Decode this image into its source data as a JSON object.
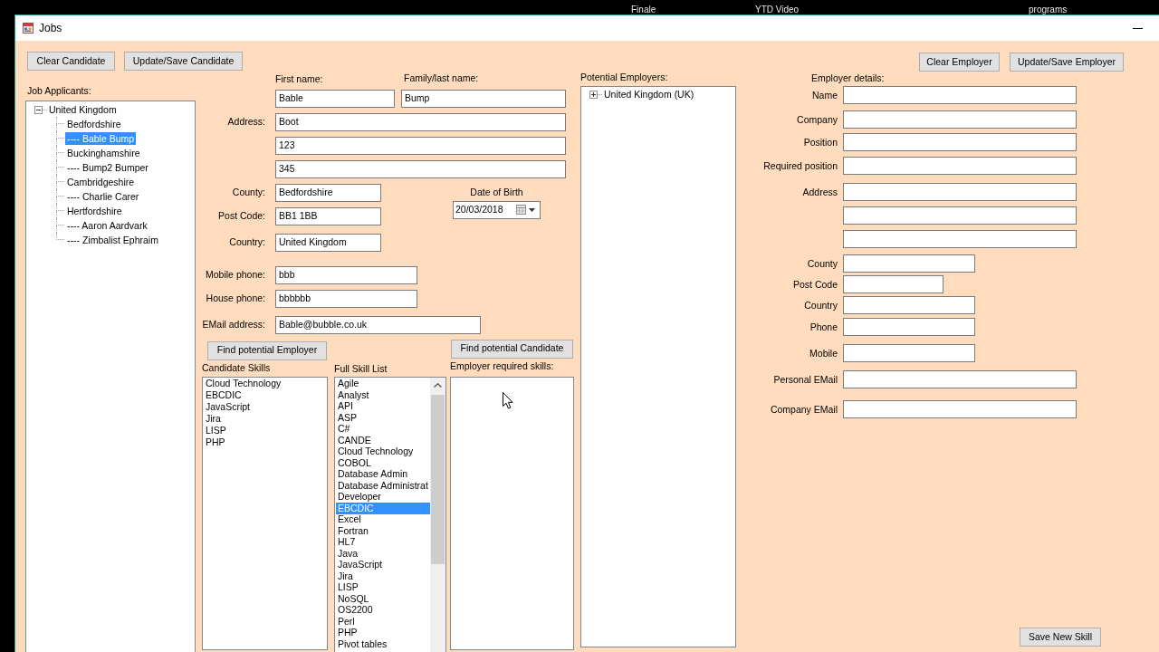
{
  "desktop": {
    "labels": [
      "Finale",
      "YTD Video",
      "programs"
    ]
  },
  "window": {
    "title": "Jobs"
  },
  "candidate_buttons": [
    "Clear Candidate",
    "Update/Save Candidate"
  ],
  "job_applicants": {
    "label": "Job Applicants:",
    "tree": [
      {
        "text": "United Kingdom",
        "expanded": true,
        "selected": false,
        "children": [
          {
            "text": "Bedfordshire",
            "selected": false
          },
          {
            "text": "---- Bable Bump",
            "selected": true
          },
          {
            "text": "Buckinghamshire",
            "selected": false
          },
          {
            "text": "---- Bump2 Bumper",
            "selected": false
          },
          {
            "text": "Cambridgeshire",
            "selected": false
          },
          {
            "text": "---- Charlie Carer",
            "selected": false
          },
          {
            "text": "Hertfordshire",
            "selected": false
          },
          {
            "text": "---- Aaron Aardvark",
            "selected": false
          },
          {
            "text": "---- Zimbalist Ephraim",
            "selected": false
          }
        ]
      }
    ]
  },
  "candidate_form": {
    "first_name": {
      "label": "First name:",
      "value": "Bable"
    },
    "last_name": {
      "label": "Family/last name:",
      "value": "Bump"
    },
    "address": {
      "label": "Address:",
      "lines": [
        "Boot",
        "123",
        "345"
      ]
    },
    "county": {
      "label": "County:",
      "value": "Bedfordshire"
    },
    "post_code": {
      "label": "Post Code:",
      "value": "BB1 1BB"
    },
    "country": {
      "label": "Country:",
      "value": "United Kingdom"
    },
    "date_of_birth": {
      "label": "Date of Birth",
      "value": "20/03/2018"
    },
    "mobile_phone": {
      "label": "Mobile phone:",
      "value": "bbb"
    },
    "house_phone": {
      "label": "House phone:",
      "value": "bbbbbb"
    },
    "email": {
      "label": "EMail address:",
      "value": "Bable@bubble.co.uk"
    }
  },
  "find_employer_button": "Find potential Employer",
  "find_candidate_button": "Find potential Candidate",
  "candidate_skills": {
    "label": "Candidate Skills",
    "items": [
      {
        "text": "Cloud Technology",
        "selected": false
      },
      {
        "text": "EBCDIC",
        "selected": false
      },
      {
        "text": "JavaScript",
        "selected": false
      },
      {
        "text": "Jira",
        "selected": false
      },
      {
        "text": "LISP",
        "selected": false
      },
      {
        "text": "PHP",
        "selected": false
      }
    ]
  },
  "full_skill_list": {
    "label": "Full Skill List",
    "items": [
      {
        "text": "Agile",
        "selected": false
      },
      {
        "text": "Analyst",
        "selected": false
      },
      {
        "text": "API",
        "selected": false
      },
      {
        "text": "ASP",
        "selected": false
      },
      {
        "text": "C#",
        "selected": false
      },
      {
        "text": "CANDE",
        "selected": false
      },
      {
        "text": "Cloud Technology",
        "selected": false
      },
      {
        "text": "COBOL",
        "selected": false
      },
      {
        "text": "Database Admin",
        "selected": false
      },
      {
        "text": "Database Administrat",
        "selected": false
      },
      {
        "text": "Developer",
        "selected": false
      },
      {
        "text": "EBCDIC",
        "selected": true
      },
      {
        "text": "Excel",
        "selected": false
      },
      {
        "text": "Fortran",
        "selected": false
      },
      {
        "text": "HL7",
        "selected": false
      },
      {
        "text": "Java",
        "selected": false
      },
      {
        "text": "JavaScript",
        "selected": false
      },
      {
        "text": "Jira",
        "selected": false
      },
      {
        "text": "LISP",
        "selected": false
      },
      {
        "text": "NoSQL",
        "selected": false
      },
      {
        "text": "OS2200",
        "selected": false
      },
      {
        "text": "Perl",
        "selected": false
      },
      {
        "text": "PHP",
        "selected": false
      },
      {
        "text": "Pivot tables",
        "selected": false
      }
    ]
  },
  "employer_required_skills": {
    "label": "Employer required skills:"
  },
  "potential_employers": {
    "label": "Potential Employers:",
    "tree": [
      {
        "text": "United Kingdom (UK)",
        "expanded": false,
        "selected": false
      }
    ]
  },
  "employer_buttons": [
    "Clear Employer",
    "Update/Save Employer"
  ],
  "employer_details": {
    "label": "Employer details:",
    "fields": [
      {
        "label": "Name",
        "kind": "wide"
      },
      {
        "label": "Company",
        "kind": "wide"
      },
      {
        "label": "Position",
        "kind": "wide"
      },
      {
        "label": "Required position",
        "kind": "wide"
      },
      {
        "label": "Address",
        "kind": "wide"
      },
      {
        "kind": "wide"
      },
      {
        "kind": "wide"
      },
      {
        "label": "County",
        "kind": "medium"
      },
      {
        "label": "Post Code",
        "kind": "short"
      },
      {
        "label": "Country",
        "kind": "medium"
      },
      {
        "label": "Phone",
        "kind": "medium"
      },
      {
        "label": "Mobile",
        "kind": "medium"
      },
      {
        "label": "Personal EMail",
        "kind": "wide"
      },
      {
        "label": "Company EMail",
        "kind": "wide"
      }
    ]
  },
  "save_skill_button": "Save New Skill"
}
